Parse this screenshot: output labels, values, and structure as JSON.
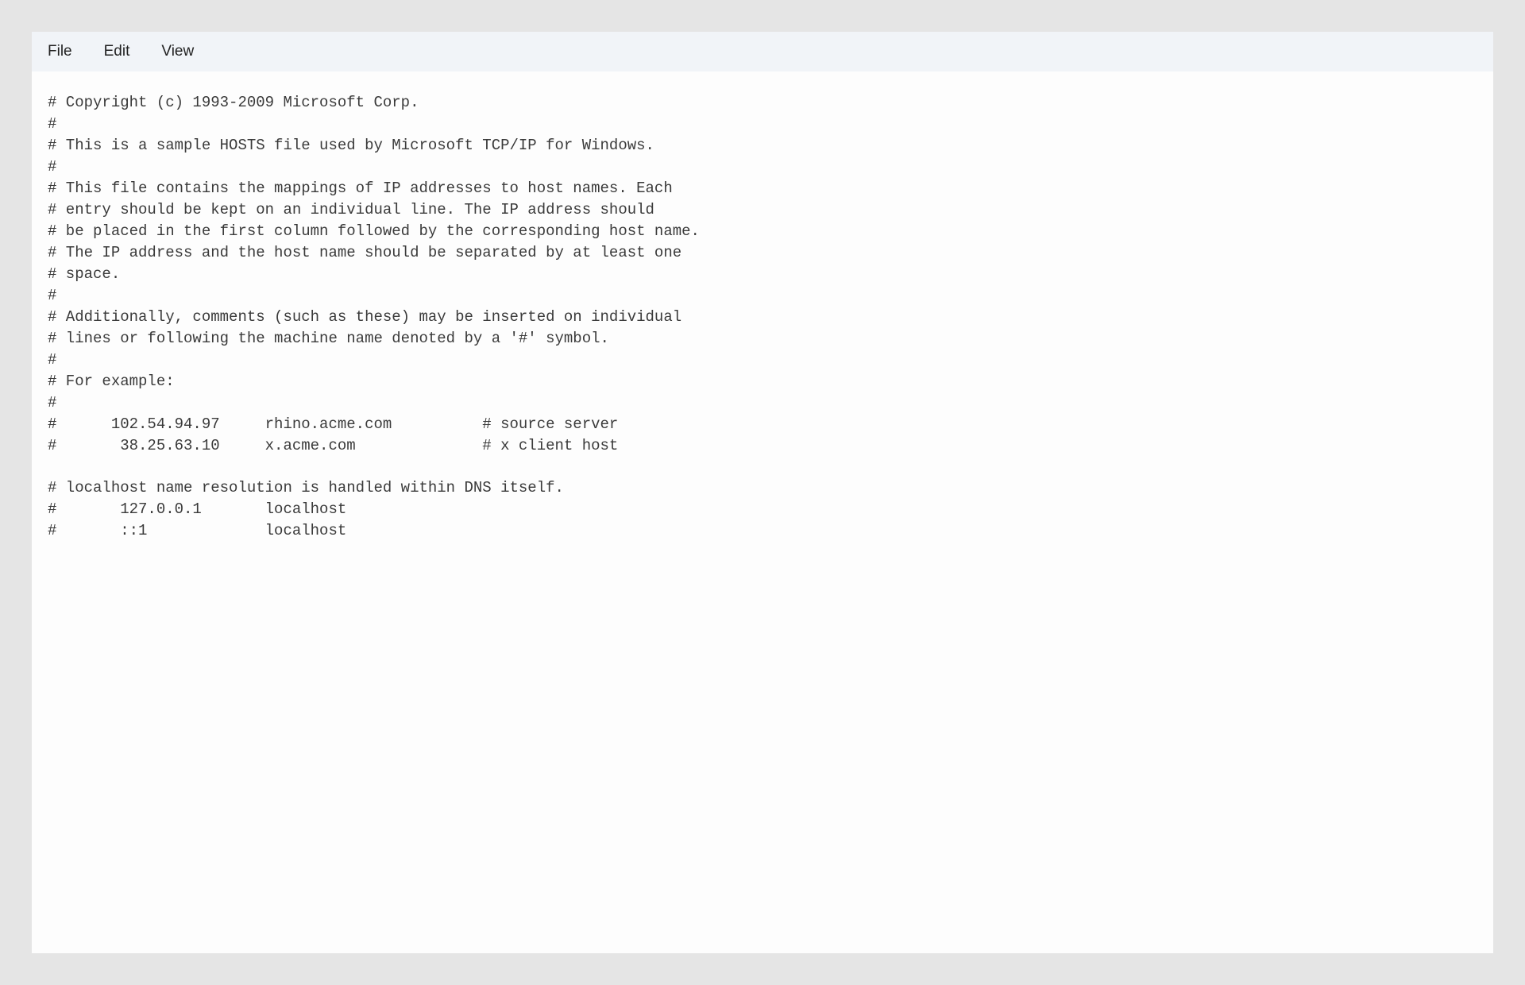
{
  "menu": {
    "file": "File",
    "edit": "Edit",
    "view": "View"
  },
  "content": {
    "lines": [
      "# Copyright (c) 1993-2009 Microsoft Corp.",
      "#",
      "# This is a sample HOSTS file used by Microsoft TCP/IP for Windows.",
      "#",
      "# This file contains the mappings of IP addresses to host names. Each",
      "# entry should be kept on an individual line. The IP address should",
      "# be placed in the first column followed by the corresponding host name.",
      "# The IP address and the host name should be separated by at least one",
      "# space.",
      "#",
      "# Additionally, comments (such as these) may be inserted on individual",
      "# lines or following the machine name denoted by a '#' symbol.",
      "#",
      "# For example:",
      "#",
      "#      102.54.94.97     rhino.acme.com          # source server",
      "#       38.25.63.10     x.acme.com              # x client host",
      "",
      "# localhost name resolution is handled within DNS itself.",
      "#       127.0.0.1       localhost",
      "#       ::1             localhost"
    ]
  }
}
